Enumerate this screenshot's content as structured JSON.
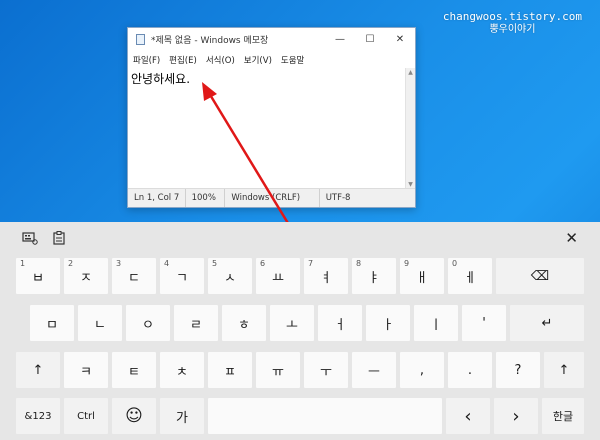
{
  "watermark": {
    "line1": "changwoos.tistory.com",
    "line2": "뿡우이야기"
  },
  "notepad": {
    "title": "*제목 없음 - Windows 메모장",
    "controls": {
      "minimize": "—",
      "maximize": "☐",
      "close": "✕"
    },
    "menu": [
      "파일(F)",
      "편집(E)",
      "서식(O)",
      "보기(V)",
      "도움말"
    ],
    "content": "안녕하세요.",
    "status": {
      "position": "Ln 1, Col 7",
      "zoom": "100%",
      "line_ending": "Windows (CRLF)",
      "encoding": "UTF-8"
    }
  },
  "keyboard": {
    "close": "✕",
    "row1": [
      {
        "num": "1",
        "label": "ㅂ"
      },
      {
        "num": "2",
        "label": "ㅈ"
      },
      {
        "num": "3",
        "label": "ㄷ"
      },
      {
        "num": "4",
        "label": "ㄱ"
      },
      {
        "num": "5",
        "label": "ㅅ"
      },
      {
        "num": "6",
        "label": "ㅛ"
      },
      {
        "num": "7",
        "label": "ㅕ"
      },
      {
        "num": "8",
        "label": "ㅑ"
      },
      {
        "num": "9",
        "label": "ㅐ"
      },
      {
        "num": "0",
        "label": "ㅔ"
      }
    ],
    "backspace": "⌫",
    "row2": [
      "ㅁ",
      "ㄴ",
      "ㅇ",
      "ㄹ",
      "ㅎ",
      "ㅗ",
      "ㅓ",
      "ㅏ",
      "ㅣ",
      "'"
    ],
    "enter": "↵",
    "shift": "↑",
    "row3": [
      "ㅋ",
      "ㅌ",
      "ㅊ",
      "ㅍ",
      "ㅠ",
      "ㅜ",
      "ㅡ",
      ",",
      ".",
      "?"
    ],
    "row4": {
      "symbols": "&123",
      "ctrl": "Ctrl",
      "emoji": "☺",
      "hanja": "가",
      "space": "",
      "left": "‹",
      "right": "›",
      "lang": "한글"
    }
  }
}
